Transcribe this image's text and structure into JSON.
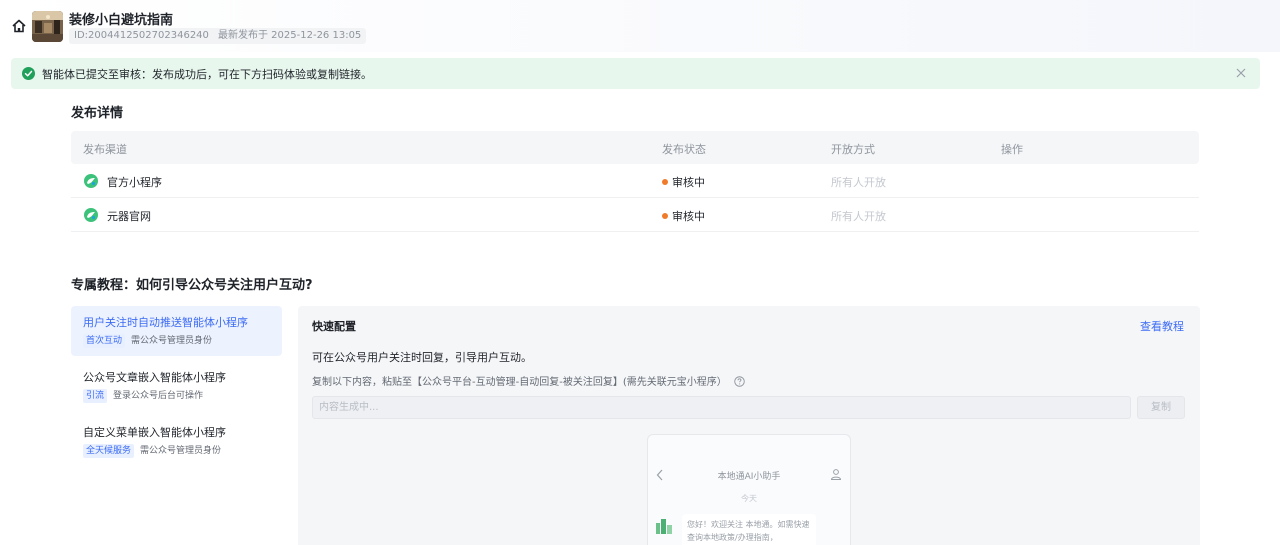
{
  "header": {
    "title": "装修小白避坑指南",
    "id_text": "ID:2004412502702346240",
    "publish_time": "最新发布于 2025-12-26 13:05"
  },
  "alert": {
    "text": "智能体已提交至审核：发布成功后，可在下方扫码体验或复制链接。"
  },
  "publish_details": {
    "title": "发布详情",
    "columns": [
      "发布渠道",
      "发布状态",
      "开放方式",
      "操作"
    ],
    "rows": [
      {
        "channel": "官方小程序",
        "status": "审核中",
        "access": "所有人开放"
      },
      {
        "channel": "元器官网",
        "status": "审核中",
        "access": "所有人开放"
      }
    ]
  },
  "tutorial": {
    "title": "专属教程：如何引导公众号关注用户互动?",
    "items": [
      {
        "title": "用户关注时自动推送智能体小程序",
        "tag": "首次互动",
        "desc": "需公众号管理员身份"
      },
      {
        "title": "公众号文章嵌入智能体小程序",
        "tag": "引流",
        "desc": "登录公众号后台可操作"
      },
      {
        "title": "自定义菜单嵌入智能体小程序",
        "tag": "全天候服务",
        "desc": "需公众号管理员身份"
      }
    ]
  },
  "config": {
    "title": "快速配置",
    "link": "查看教程",
    "line1": "可在公众号用户关注时回复，引导用户互动。",
    "line2": "复制以下内容，粘贴至【公众号平台-互动管理-自动回复-被关注回复】(需先关联元宝小程序）",
    "input_placeholder": "内容生成中...",
    "copy_button": "复制"
  },
  "phone_preview": {
    "title": "本地通AI小助手",
    "time": "今天",
    "bubble": "您好！欢迎关注 本地通。如需快速查询本地政策/办理指南，"
  },
  "colors": {
    "accent": "#3d6cf4",
    "success": "#20a05a",
    "alert_bg": "#e8f7ee",
    "status_pending": "#f07b2b"
  }
}
